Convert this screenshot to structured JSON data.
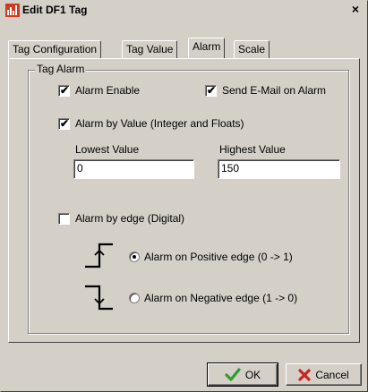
{
  "window": {
    "title": "Edit DF1 Tag",
    "close_symbol": "×"
  },
  "tabs": [
    {
      "label": "Tag Configuration",
      "active": false
    },
    {
      "label": "Tag Value",
      "active": false
    },
    {
      "label": "Alarm",
      "active": true
    },
    {
      "label": "Scale",
      "active": false
    }
  ],
  "group": {
    "legend": "Tag Alarm"
  },
  "options": {
    "alarm_enable": {
      "label": "Alarm Enable",
      "checked": true
    },
    "send_email": {
      "label": "Send E-Mail on Alarm",
      "checked": true
    },
    "alarm_by_value": {
      "label": "Alarm by Value (Integer and Floats)",
      "checked": true
    },
    "alarm_by_edge": {
      "label": "Alarm by edge (Digital)",
      "checked": false
    }
  },
  "values": {
    "lowest_label": "Lowest Value",
    "lowest_value": "0",
    "highest_label": "Highest Value",
    "highest_value": "150"
  },
  "edges": {
    "positive": {
      "label": "Alarm on Positive edge (0 -> 1)",
      "selected": true,
      "icon": "rising-edge-icon"
    },
    "negative": {
      "label": "Alarm on Negative edge (1 -> 0)",
      "selected": false,
      "icon": "falling-edge-icon"
    }
  },
  "buttons": {
    "ok_label": "OK",
    "cancel_label": "Cancel"
  },
  "colors": {
    "dialog_face": "#d4d0c8",
    "ok_check": "#2e9e2e",
    "cancel_x": "#cc2222",
    "title_icon_red": "#d03a1f"
  }
}
